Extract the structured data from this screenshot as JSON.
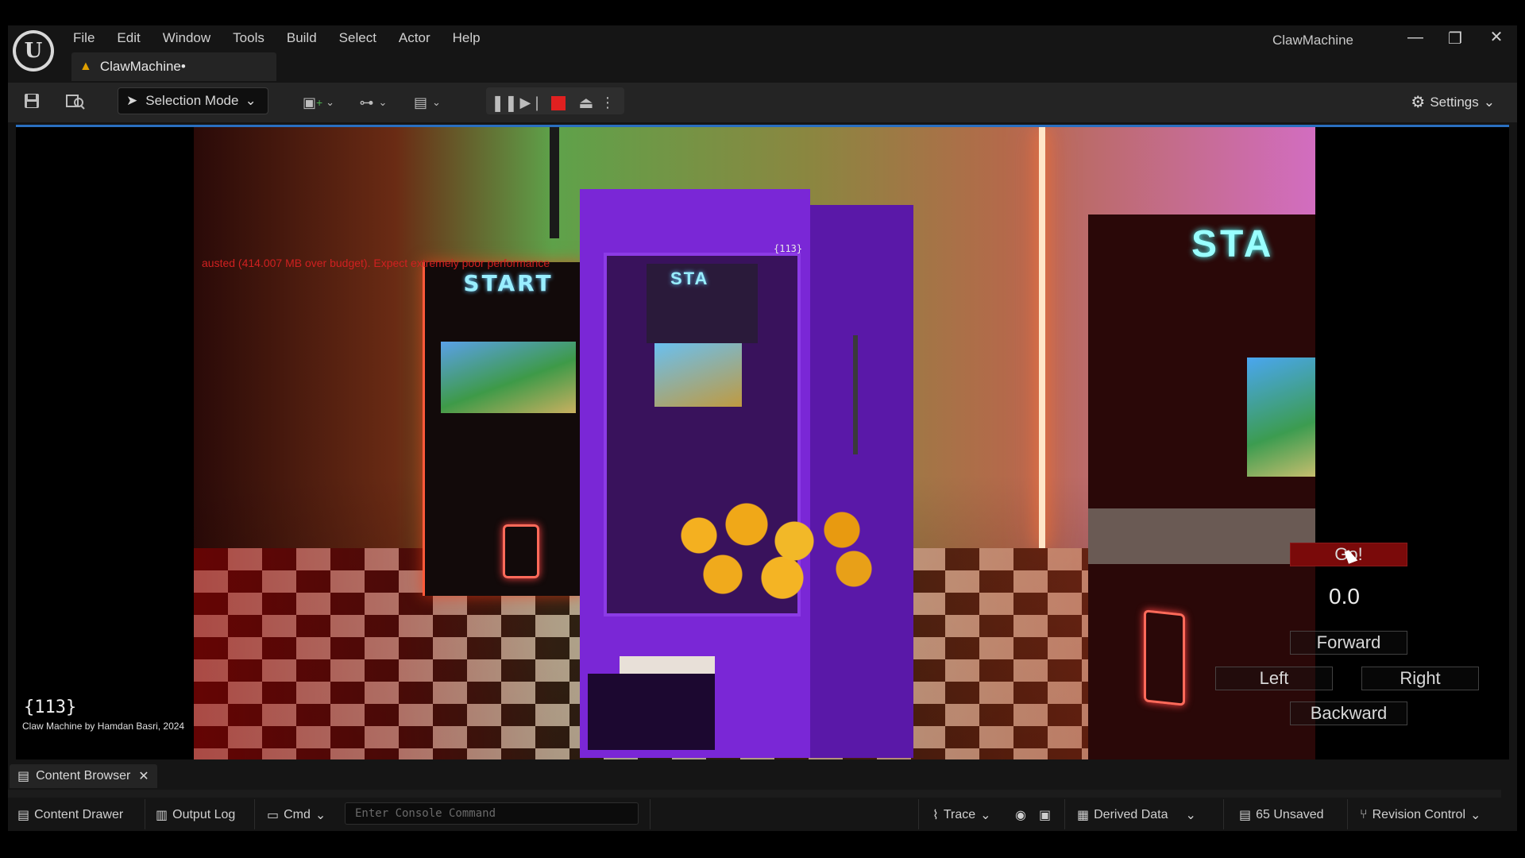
{
  "app": {
    "window_title": "ClawMachine",
    "doc_tab": "ClawMachine•",
    "logo_letter": "U",
    "menu": [
      "File",
      "Edit",
      "Window",
      "Tools",
      "Build",
      "Select",
      "Actor",
      "Help"
    ],
    "window_controls": {
      "minimize": "—",
      "restore": "❐",
      "close": "✕"
    }
  },
  "toolbar": {
    "selection_mode": "Selection Mode",
    "settings": "Settings"
  },
  "viewport": {
    "warning": "austed (414.007 MB over budget). Expect extremely poor performance",
    "logo_text": "{113}",
    "credit": "Claw Machine by Hamdan Basri, 2024",
    "marquee_left": "START",
    "marquee_center": "STA",
    "marquee_right": "STA",
    "claw_sign": "{113}",
    "hud": {
      "go": "Go!",
      "value": "0.0",
      "forward": "Forward",
      "left": "Left",
      "right": "Right",
      "backward": "Backward"
    }
  },
  "bottom": {
    "content_browser_tab": "Content Browser",
    "content_drawer": "Content Drawer",
    "output_log": "Output Log",
    "cmd": "Cmd",
    "console_placeholder": "Enter Console Command",
    "trace": "Trace",
    "derived_data": "Derived Data",
    "unsaved": "65 Unsaved",
    "revision_control": "Revision Control"
  },
  "colors": {
    "accent_blue": "#2a6fc0",
    "stop_red": "#e02020",
    "warning_text": "#d02020",
    "claw_purple": "#7a27d6"
  }
}
